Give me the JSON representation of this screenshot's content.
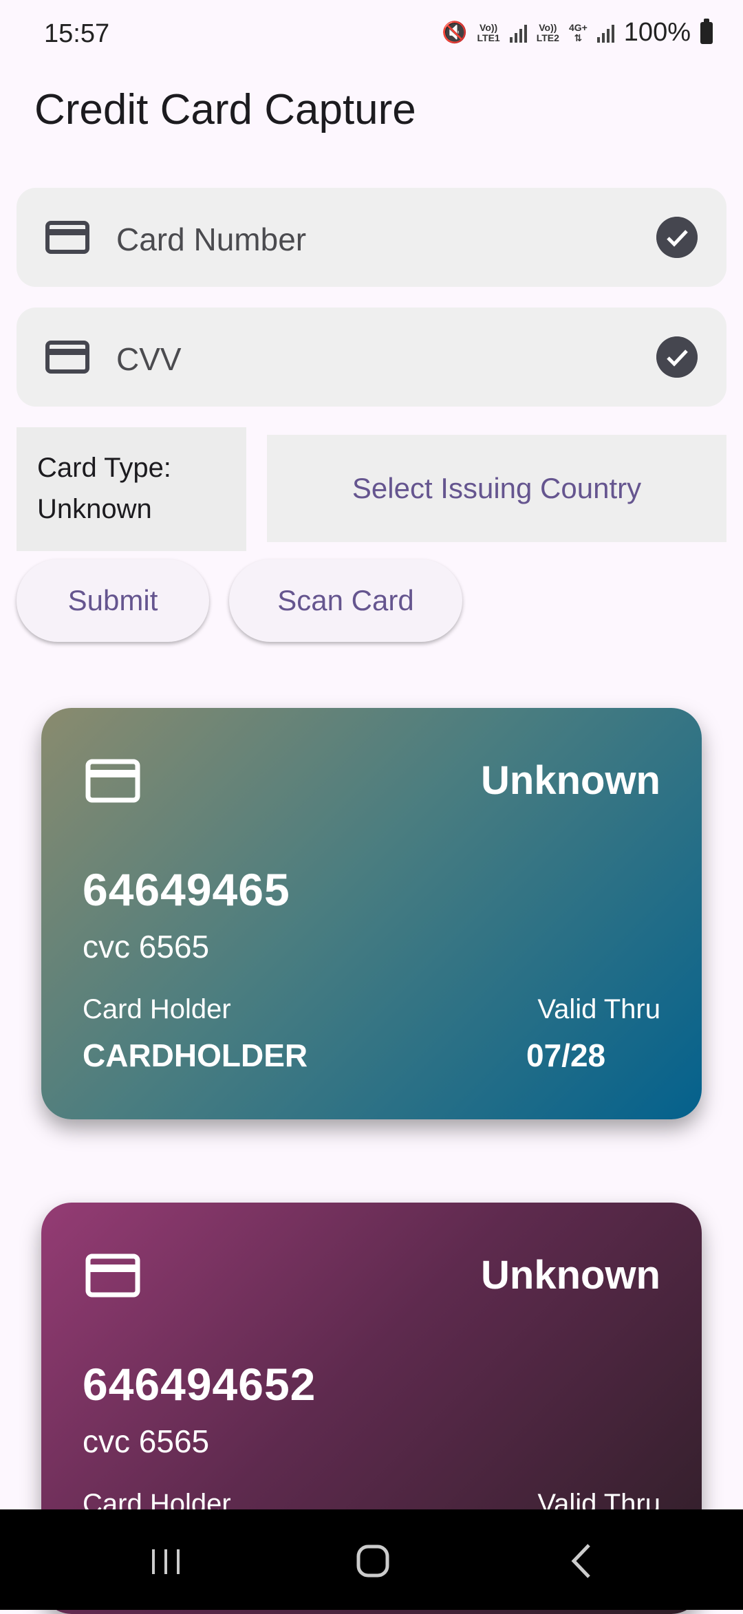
{
  "status_bar": {
    "time": "15:57",
    "sim1_top": "Vo))",
    "sim1_bottom": "LTE1",
    "sim2_top": "Vo))",
    "sim2_bottom": "LTE2",
    "network_type": "4G+",
    "battery": "100%"
  },
  "app": {
    "title": "Credit Card Capture"
  },
  "fields": {
    "card_number_label": "Card Number",
    "cvv_label": "CVV"
  },
  "card_type": {
    "label": "Card Type:",
    "value": "Unknown"
  },
  "buttons": {
    "select_country": "Select Issuing Country",
    "submit": "Submit",
    "scan": "Scan Card"
  },
  "cards": [
    {
      "type": "Unknown",
      "number": "64649465",
      "cvc": "cvc 6565",
      "holder_label": "Card Holder",
      "holder": "CARDHOLDER",
      "valid_label": "Valid Thru",
      "valid": "07/28"
    },
    {
      "type": "Unknown",
      "number": "646494652",
      "cvc": "cvc 6565",
      "holder_label": "Card Holder",
      "valid_label": "Valid Thru"
    }
  ],
  "icons": {
    "field_icon": "credit-card-icon",
    "field_status": "check-circle-icon",
    "nav": [
      "recent-apps-icon",
      "home-icon",
      "back-icon"
    ]
  }
}
